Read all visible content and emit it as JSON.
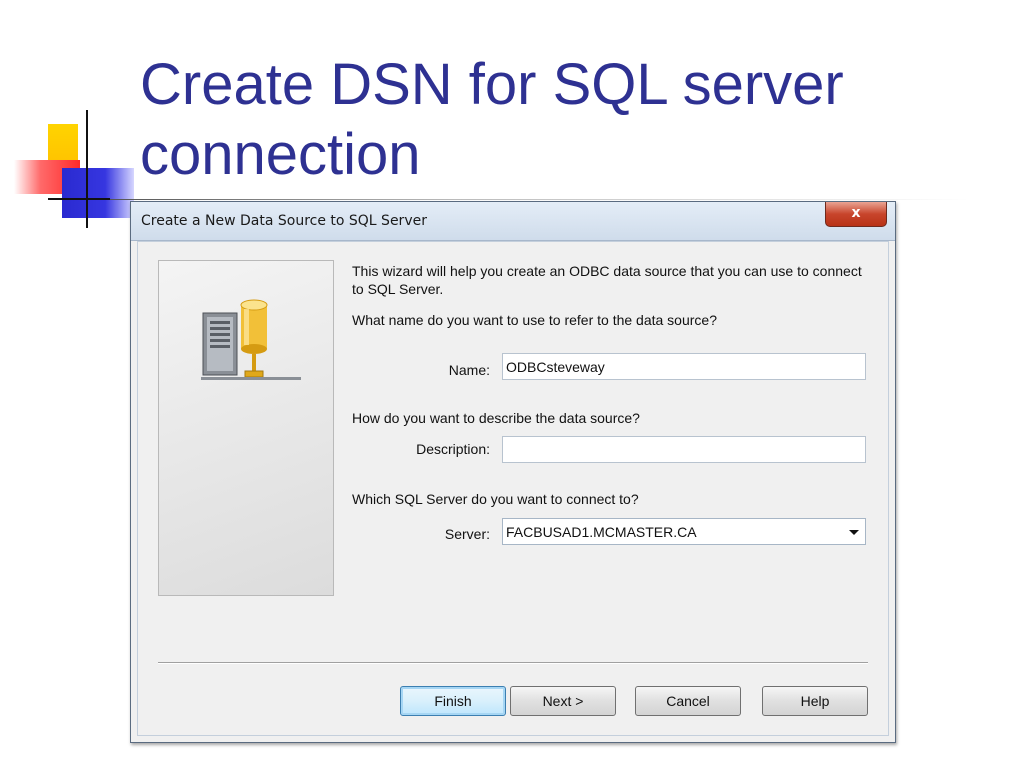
{
  "slide": {
    "title_line1": "Create DSN for SQL server",
    "title_line2": "connection",
    "title_color": "#2e3192"
  },
  "dialog": {
    "title": "Create a New Data Source to SQL Server",
    "close_label": "x",
    "intro_text": "This wizard will help you create an ODBC data source that you can use to connect to SQL Server.",
    "name_question": "What name do you want to use to refer to the data source?",
    "name_label": "Name:",
    "name_value": "ODBCsteveway",
    "description_question": "How do you want to describe the data source?",
    "description_label": "Description:",
    "description_value": "",
    "server_question": "Which SQL Server do you want to connect to?",
    "server_label": "Server:",
    "server_value": "FACBUSAD1.MCMASTER.CA",
    "icon": "server-database-icon"
  },
  "buttons": {
    "finish": "Finish",
    "next": "Next >",
    "cancel": "Cancel",
    "help": "Help"
  }
}
